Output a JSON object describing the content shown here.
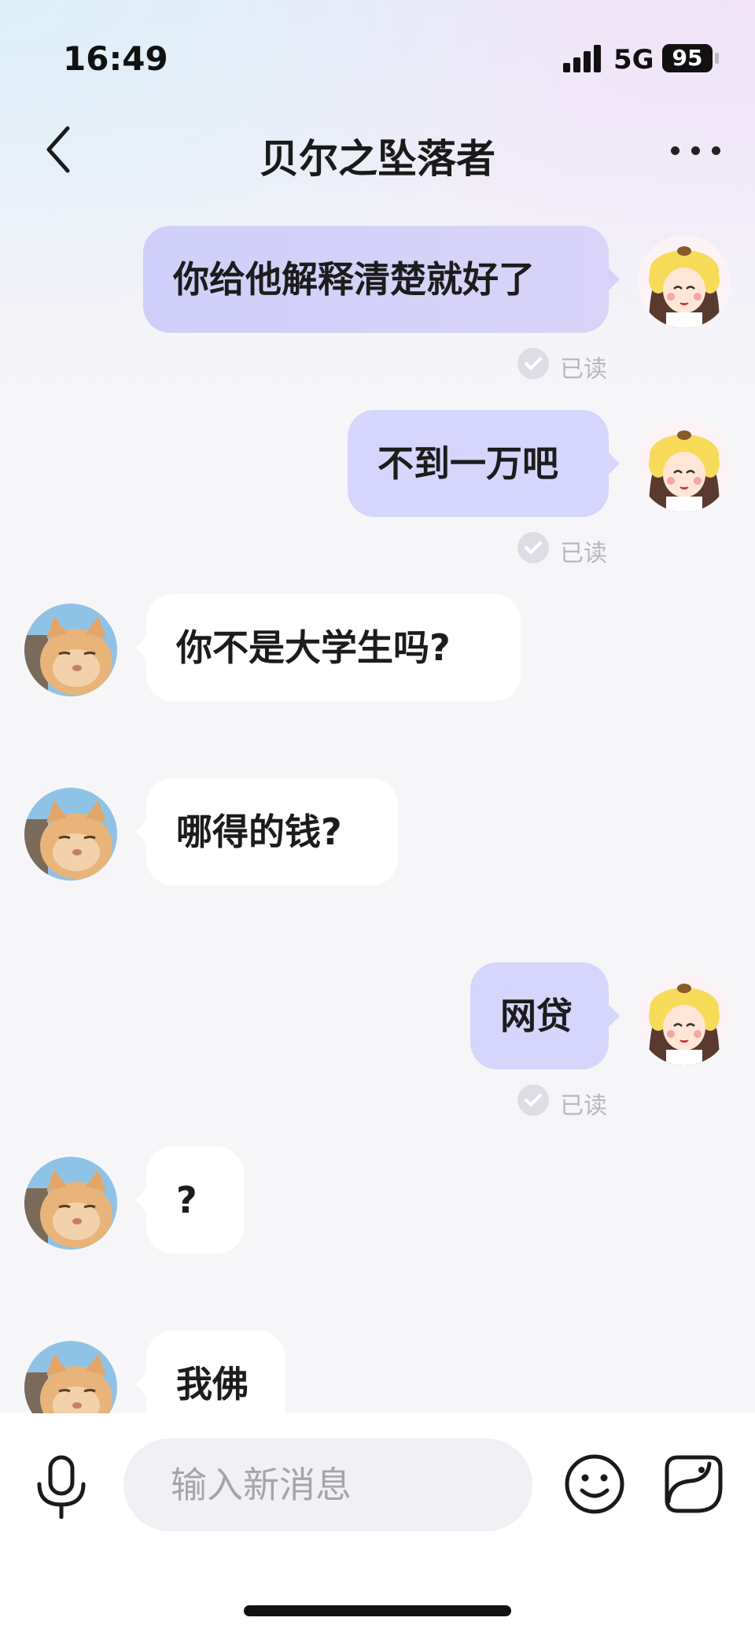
{
  "status_bar": {
    "time": "16:49",
    "network": "5G",
    "battery": "95"
  },
  "header": {
    "title": "贝尔之坠落者",
    "back_icon": "chevron-left-icon",
    "more_icon": "more-dots-icon"
  },
  "messages": [
    {
      "from": "me",
      "text": "你给他解释清楚就好了",
      "status": "已读"
    },
    {
      "from": "me",
      "text": "不到一万吧",
      "status": "已读"
    },
    {
      "from": "them",
      "text": "你不是大学生吗?"
    },
    {
      "from": "them",
      "text": "哪得的钱?"
    },
    {
      "from": "me",
      "text": "网贷",
      "status": "已读"
    },
    {
      "from": "them",
      "text": "?"
    },
    {
      "from": "them",
      "text": "我佛"
    }
  ],
  "composer": {
    "placeholder": "输入新消息",
    "mic_icon": "microphone-icon",
    "emoji_icon": "emoji-icon",
    "sticker_icon": "sticker-icon"
  },
  "colors": {
    "my_bubble": "#d6d5fb",
    "their_bubble": "#ffffff",
    "background": "#f6f6f9"
  }
}
